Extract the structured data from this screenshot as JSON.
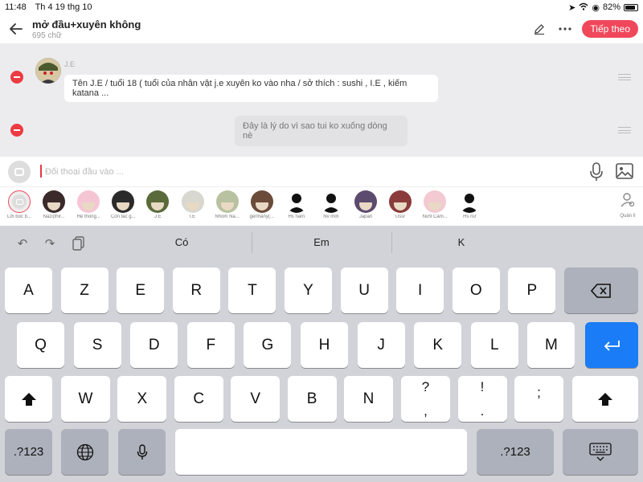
{
  "status": {
    "time": "11:48",
    "date": "Th 4 19 thg 10",
    "battery": "82%"
  },
  "header": {
    "title": "mở đầu+xuyên không",
    "subtitle": "695 chữ",
    "next_label": "Tiếp theo"
  },
  "messages": [
    {
      "speaker": "J.E",
      "text": "Tên J.E / tuổi 18 ( tuổi của nhân vật j.e xuyên ko vào nha / sở thích : sushi , I.E , kiếm katana ..."
    },
    {
      "speaker": "",
      "text": "Đây là lý do vì sao tui ko xuống dòng nè"
    }
  ],
  "composer": {
    "placeholder": "Đối thoại đầu vào ..."
  },
  "characters": [
    {
      "name": "Lời bốc b...",
      "color": "#e9e9e9",
      "icon": "narrator-icon"
    },
    {
      "name": "Nazi(thir...",
      "color": "#3b2a2a",
      "icon": "avatar-dark"
    },
    {
      "name": "Hệ thống...",
      "color": "#f6c5d4",
      "icon": "avatar-pink"
    },
    {
      "name": "Con tác g...",
      "color": "#2b2b2b",
      "icon": "avatar-dark"
    },
    {
      "name": "J.E",
      "color": "#5a6a3a",
      "icon": "avatar-green"
    },
    {
      "name": "I.E",
      "color": "#d8d8d0",
      "icon": "avatar-light"
    },
    {
      "name": "Nhóm Na...",
      "color": "#b8c2a0",
      "icon": "avatar-olive"
    },
    {
      "name": "germany(...",
      "color": "#6b4b3a",
      "icon": "avatar-brown"
    },
    {
      "name": "Hs nam",
      "color": "#111111",
      "icon": "silhouette"
    },
    {
      "name": "Nv mới",
      "color": "#111111",
      "icon": "silhouette"
    },
    {
      "name": "Japan",
      "color": "#5c4b6e",
      "icon": "avatar-purple"
    },
    {
      "name": "Ussr",
      "color": "#8b3b3b",
      "icon": "avatar-red"
    },
    {
      "name": "Nữ9 Câm...",
      "color": "#f3c9d2",
      "icon": "avatar-pink"
    },
    {
      "name": "Hs nữ",
      "color": "#111111",
      "icon": "silhouette"
    }
  ],
  "manage_label": "Quản lí",
  "keyboard": {
    "suggestions": [
      "Có",
      "Em",
      "K"
    ],
    "row1": [
      "A",
      "Z",
      "E",
      "R",
      "T",
      "Y",
      "U",
      "I",
      "O",
      "P"
    ],
    "row2": [
      "Q",
      "S",
      "D",
      "F",
      "G",
      "H",
      "J",
      "K",
      "L",
      "M"
    ],
    "row3": [
      "W",
      "X",
      "C",
      "V",
      "B",
      "N"
    ],
    "punct": [
      [
        "?",
        ","
      ],
      [
        "!",
        "."
      ],
      [
        ";",
        ""
      ]
    ],
    "numbers_label": ".?123"
  },
  "colors": {
    "accent": "#f0475a",
    "minus": "#ec3b42",
    "return": "#1a7df7"
  }
}
